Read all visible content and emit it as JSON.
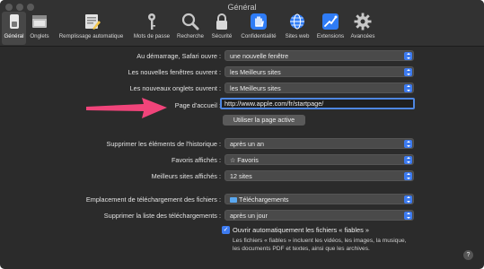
{
  "window": {
    "title": "Général"
  },
  "toolbar": {
    "items": [
      {
        "label": "Général",
        "icon": "general-switch-icon"
      },
      {
        "label": "Onglets",
        "icon": "tabs-icon"
      },
      {
        "label": "Remplissage automatique",
        "icon": "autofill-icon"
      },
      {
        "label": "Mots de passe",
        "icon": "key-icon"
      },
      {
        "label": "Recherche",
        "icon": "magnifier-icon"
      },
      {
        "label": "Sécurité",
        "icon": "lock-icon"
      },
      {
        "label": "Confidentialité",
        "icon": "hand-icon"
      },
      {
        "label": "Sites web",
        "icon": "globe-icon"
      },
      {
        "label": "Extensions",
        "icon": "puzzle-icon"
      },
      {
        "label": "Avancées",
        "icon": "gear-icon"
      }
    ]
  },
  "prefs": {
    "startup_label": "Au démarrage, Safari ouvre :",
    "startup_value": "une nouvelle fenêtre",
    "new_windows_label": "Les nouvelles fenêtres ouvrent :",
    "new_windows_value": "les Meilleurs sites",
    "new_tabs_label": "Les nouveaux onglets ouvrent :",
    "new_tabs_value": "les Meilleurs sites",
    "homepage_label": "Page d'accueil :",
    "homepage_value": "http://www.apple.com/fr/startpage/",
    "use_current_page": "Utiliser la page active",
    "history_label": "Supprimer les éléments de l'historique :",
    "history_value": "après un an",
    "favorites_label": "Favoris affichés :",
    "favorites_value": "Favoris",
    "top_sites_label": "Meilleurs sites affichés :",
    "top_sites_value": "12 sites",
    "download_location_label": "Emplacement de téléchargement des fichiers :",
    "download_location_value": "Téléchargements",
    "remove_downloads_label": "Supprimer la liste des téléchargements :",
    "remove_downloads_value": "après un jour",
    "open_safe_files_label": "Ouvrir automatiquement les fichiers « fiables »",
    "open_safe_files_desc": "Les fichiers « fiables » incluent les vidéos, les images, la musique, les documents PDF et textes, ainsi que les archives.",
    "help": "?"
  },
  "colors": {
    "accent": "#3d7bf0",
    "annotation_arrow": "#f0447a"
  }
}
